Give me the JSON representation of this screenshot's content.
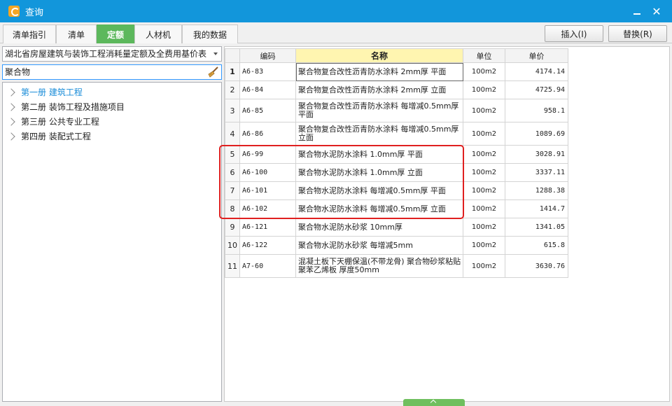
{
  "window": {
    "title": "查询"
  },
  "tabs": [
    {
      "label": "清单指引"
    },
    {
      "label": "清单"
    },
    {
      "label": "定额"
    },
    {
      "label": "人材机"
    },
    {
      "label": "我的数据"
    }
  ],
  "actions": {
    "insert": "插入(I)",
    "replace": "替换(R)"
  },
  "left": {
    "combo_value": "湖北省房屋建筑与装饰工程消耗量定额及全费用基价表",
    "search_value": "聚合物",
    "tree": [
      {
        "label": "第一册 建筑工程"
      },
      {
        "label": "第二册 装饰工程及措施项目"
      },
      {
        "label": "第三册 公共专业工程"
      },
      {
        "label": "第四册 装配式工程"
      }
    ]
  },
  "grid": {
    "headers": {
      "code": "编码",
      "name": "名称",
      "unit": "单位",
      "price": "单价"
    },
    "rows": [
      {
        "idx": "1",
        "code": "A6-83",
        "name": "聚合物复合改性沥青防水涂料 2mm厚 平面",
        "unit": "100m2",
        "price": "4174.14"
      },
      {
        "idx": "2",
        "code": "A6-84",
        "name": "聚合物复合改性沥青防水涂料 2mm厚 立面",
        "unit": "100m2",
        "price": "4725.94"
      },
      {
        "idx": "3",
        "code": "A6-85",
        "name": "聚合物复合改性沥青防水涂料 每增减0.5mm厚 平面",
        "unit": "100m2",
        "price": "958.1"
      },
      {
        "idx": "4",
        "code": "A6-86",
        "name": "聚合物复合改性沥青防水涂料 每增减0.5mm厚 立面",
        "unit": "100m2",
        "price": "1089.69"
      },
      {
        "idx": "5",
        "code": "A6-99",
        "name": "聚合物水泥防水涂料 1.0mm厚 平面",
        "unit": "100m2",
        "price": "3028.91"
      },
      {
        "idx": "6",
        "code": "A6-100",
        "name": "聚合物水泥防水涂料 1.0mm厚 立面",
        "unit": "100m2",
        "price": "3337.11"
      },
      {
        "idx": "7",
        "code": "A6-101",
        "name": "聚合物水泥防水涂料 每增减0.5mm厚 平面",
        "unit": "100m2",
        "price": "1288.38"
      },
      {
        "idx": "8",
        "code": "A6-102",
        "name": "聚合物水泥防水涂料 每增减0.5mm厚 立面",
        "unit": "100m2",
        "price": "1414.7"
      },
      {
        "idx": "9",
        "code": "A6-121",
        "name": "聚合物水泥防水砂浆 10mm厚",
        "unit": "100m2",
        "price": "1341.05"
      },
      {
        "idx": "10",
        "code": "A6-122",
        "name": "聚合物水泥防水砂浆 每增减5mm",
        "unit": "100m2",
        "price": "615.8"
      },
      {
        "idx": "11",
        "code": "A7-60",
        "name": "混凝土板下天棚保温(不带龙骨) 聚合物砂浆粘贴聚苯乙烯板 厚度50mm",
        "unit": "100m2",
        "price": "3630.76"
      }
    ]
  },
  "colors": {
    "titlebar": "#1296db",
    "active_tab": "#5cb85c",
    "highlight": "#e02020",
    "name_header": "#fff5b0"
  }
}
